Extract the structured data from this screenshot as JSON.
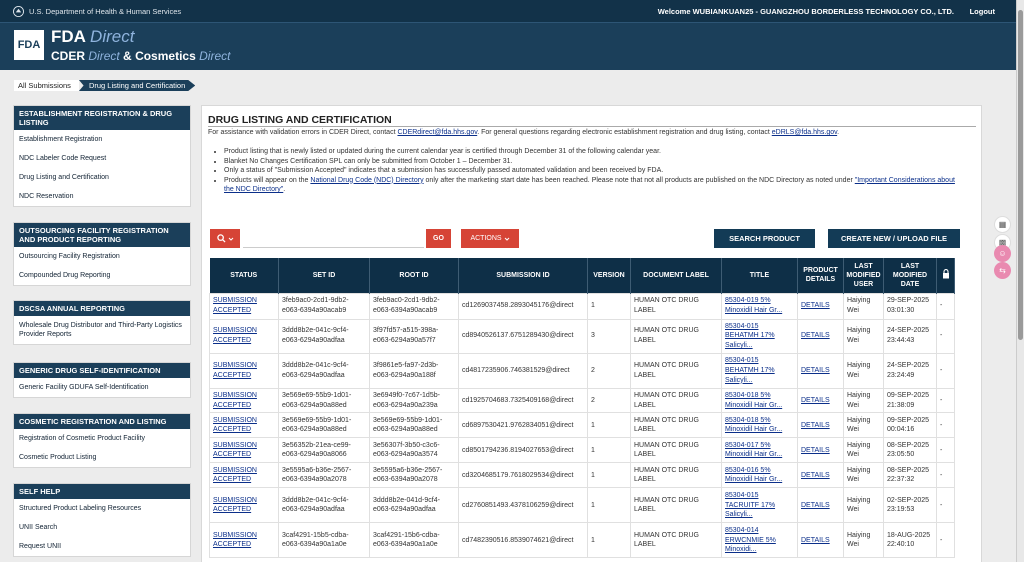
{
  "topbar": {
    "agency": "U.S. Department of Health & Human Services",
    "welcome": "Welcome WUBIANKUAN25 - GUANGZHOU BORDERLESS TECHNOLOGY CO., LTD.",
    "logout": "Logout"
  },
  "header": {
    "fda_box": "FDA",
    "line1_main": "FDA",
    "line1_italic": "Direct",
    "line2_cder": "CDER",
    "line2_direct": "Direct",
    "line2_amp": "&",
    "line2_cosmetics": "Cosmetics",
    "line2_direct2": "Direct"
  },
  "breadcrumb": {
    "home": "All Submissions",
    "current": "Drug Listing and Certification"
  },
  "sidebar": [
    {
      "title": "ESTABLISHMENT REGISTRATION & DRUG LISTING",
      "items": [
        "Establishment Registration",
        "NDC Labeler Code Request",
        "Drug Listing and Certification",
        "NDC Reservation"
      ]
    },
    {
      "title": "OUTSOURCING FACILITY REGISTRATION AND PRODUCT REPORTING",
      "items": [
        "Outsourcing Facility Registration",
        "Compounded Drug Reporting"
      ]
    },
    {
      "title": "DSCSA ANNUAL REPORTING",
      "items": [
        "Wholesale Drug Distributor and Third-Party Logistics Provider Reports"
      ]
    },
    {
      "title": "GENERIC DRUG SELF-IDENTIFICATION",
      "items": [
        "Generic Facility GDUFA Self-Identification"
      ]
    },
    {
      "title": "COSMETIC REGISTRATION AND LISTING",
      "items": [
        "Registration of Cosmetic Product Facility",
        "Cosmetic Product Listing"
      ]
    },
    {
      "title": "SELF HELP",
      "items": [
        "Structured Product Labeling Resources",
        "UNII Search",
        "Request UNII"
      ]
    }
  ],
  "main": {
    "title": "DRUG LISTING AND CERTIFICATION",
    "assist_pre": "For assistance with validation errors in CDER Direct, contact ",
    "assist_email1": "CDERdirect@fda.hhs.gov",
    "assist_mid": ". For general questions regarding electronic establishment registration and drug listing, contact ",
    "assist_email2": "eDRLS@fda.hhs.gov",
    "assist_end": ".",
    "notes": [
      "Product listing that is newly listed or updated during the current calendar year is certified through December 31 of the following calendar year.",
      "Blanket No Changes Certification SPL can only be submitted from October 1 – December 31.",
      "Only a status of \"Submission Accepted\" indicates that a submission has successfully passed automated validation and been received by FDA."
    ],
    "note4_pre": "Products will appear on the ",
    "note4_link1": "National Drug Code (NDC) Directory",
    "note4_mid": " only after the marketing start date has been reached. Please note that not all products are published on the NDC Directory as noted under ",
    "note4_link2": "\"Important Considerations about the NDC Directory\"",
    "note4_end": "."
  },
  "toolbar": {
    "search_placeholder": "",
    "go": "GO",
    "actions": "ACTIONS",
    "search_product": "SEARCH PRODUCT",
    "create": "CREATE NEW / UPLOAD FILE"
  },
  "table": {
    "columns": [
      "STATUS",
      "SET ID",
      "ROOT ID",
      "SUBMISSION ID",
      "VERSION",
      "DOCUMENT LABEL",
      "TITLE",
      "PRODUCT DETAILS",
      "LAST MODIFIED USER",
      "LAST MODIFIED DATE"
    ],
    "rows": [
      [
        "SUBMISSION ACCEPTED",
        "3feb9ac0-2cd1-9db2-e063-6394a90acab9",
        "3feb9ac0-2cd1-9db2-e063-6394a90acab9",
        "cd1269037458.2893045176@direct",
        "1",
        "HUMAN OTC DRUG LABEL",
        "85304-019 5% Minoxidil Hair Gr...",
        "DETAILS",
        "Haiying Wei",
        "29-SEP-2025 03:01:30",
        "-"
      ],
      [
        "SUBMISSION ACCEPTED",
        "3ddd8b2e-041c-9cf4-e063-6294a90adfaa",
        "3f97fd57-a515-398a-e063-6294a90a57f7",
        "cd8940526137.6751289430@direct",
        "3",
        "HUMAN OTC DRUG LABEL",
        "85304-015 BEHATMH 17% Salicyli...",
        "DETAILS",
        "Haiying Wei",
        "24-SEP-2025 23:44:43",
        "-"
      ],
      [
        "SUBMISSION ACCEPTED",
        "3ddd8b2e-041c-9cf4-e063-6294a90adfaa",
        "3f9861e5-fa97-2d3b-e063-6294a90a188f",
        "cd4817235906.746381529@direct",
        "2",
        "HUMAN OTC DRUG LABEL",
        "85304-015 BEHATMH 17% Salicyli...",
        "DETAILS",
        "Haiying Wei",
        "24-SEP-2025 23:24:49",
        "-"
      ],
      [
        "SUBMISSION ACCEPTED",
        "3e569e69-55b9-1d01-e063-6294a90a88ed",
        "3e6949f0-7c67-1d5b-e063-6294a90a239a",
        "cd1925704683.7325409168@direct",
        "2",
        "HUMAN OTC DRUG LABEL",
        "85304-018 5% Minoxidil Hair Gr...",
        "DETAILS",
        "Haiying Wei",
        "09-SEP-2025 21:38:09",
        "-"
      ],
      [
        "SUBMISSION ACCEPTED",
        "3e569e69-55b9-1d01-e063-6294a90a88ed",
        "3e569e69-55b9-1d01-e063-6294a90a88ed",
        "cd6897530421.9762834051@direct",
        "1",
        "HUMAN OTC DRUG LABEL",
        "85304-018 5% Minoxidil Hair Gr...",
        "DETAILS",
        "Haiying Wei",
        "09-SEP-2025 00:04:16",
        "-"
      ],
      [
        "SUBMISSION ACCEPTED",
        "3e56352b-21ea-ce99-e063-6294a90a8066",
        "3e56307f-3b50-c3c6-e063-6294a90a3574",
        "cd8501794236.8194027653@direct",
        "1",
        "HUMAN OTC DRUG LABEL",
        "85304-017 5% Minoxidil Hair Gr...",
        "DETAILS",
        "Haiying Wei",
        "08-SEP-2025 23:05:50",
        "-"
      ],
      [
        "SUBMISSION ACCEPTED",
        "3e5595a6-b36e-2567-e063-6394a90a2078",
        "3e5595a6-b36e-2567-e063-6394a90a2078",
        "cd3204685179.7618029534@direct",
        "1",
        "HUMAN OTC DRUG LABEL",
        "85304-016 5% Minoxidil Hair Gr...",
        "DETAILS",
        "Haiying Wei",
        "08-SEP-2025 22:37:32",
        "-"
      ],
      [
        "SUBMISSION ACCEPTED",
        "3ddd8b2e-041c-9cf4-e063-6294a90adfaa",
        "3ddd8b2e-041d-9cf4-e063-6294a90adfaa",
        "cd2760851493.4378106259@direct",
        "1",
        "HUMAN OTC DRUG LABEL",
        "85304-015 TACRUITF 17% Salicyli...",
        "DETAILS",
        "Haiying Wei",
        "02-SEP-2025 23:19:53",
        "-"
      ],
      [
        "SUBMISSION ACCEPTED",
        "3caf4291-15b5-cdba-e063-6394a90a1a0e",
        "3caf4291-15b6-cdba-e063-6394a90a1a0e",
        "cd7482390516.8539074621@direct",
        "1",
        "HUMAN OTC DRUG LABEL",
        "85304-014 ERWCNMIE 5% Minoxidi...",
        "DETAILS",
        "Haiying Wei",
        "18-AUG-2025 22:40:10",
        "-"
      ]
    ]
  },
  "colors": {
    "navy": "#0e2f47",
    "header": "#1b3f5a",
    "red": "#d64436",
    "link": "#0b2f8a"
  }
}
